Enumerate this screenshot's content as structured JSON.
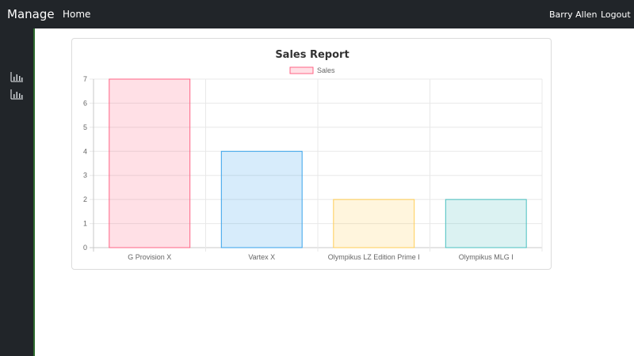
{
  "navbar": {
    "brand": "Manage",
    "home_label": "Home",
    "user_name": "Barry Allen",
    "logout_label": "Logout"
  },
  "sidebar": {
    "items": [
      {
        "icon": "bar-chart-icon"
      },
      {
        "icon": "bar-chart-icon"
      }
    ]
  },
  "colors": {
    "navbar_bg": "#212529",
    "sidebar_border": "#2d6a2d"
  },
  "chart_data": {
    "type": "bar",
    "title": "Sales Report",
    "categories": [
      "G Provision X",
      "Vartex X",
      "Olympikus LZ Edition Prime I",
      "Olympikus MLG I"
    ],
    "series": [
      {
        "name": "Sales",
        "values": [
          7,
          4,
          2,
          2
        ]
      }
    ],
    "bar_fill_colors": [
      "rgba(255,99,132,0.2)",
      "rgba(54,162,235,0.2)",
      "rgba(255,206,86,0.2)",
      "rgba(75,192,192,0.2)"
    ],
    "bar_border_colors": [
      "#ff6384",
      "#36a2eb",
      "#ffce56",
      "#4bc0c0"
    ],
    "ylim": [
      0,
      7
    ],
    "yticks": [
      "0",
      "1",
      "2",
      "3",
      "4",
      "5",
      "6",
      "7"
    ],
    "grid": true,
    "legend_position": "top"
  }
}
